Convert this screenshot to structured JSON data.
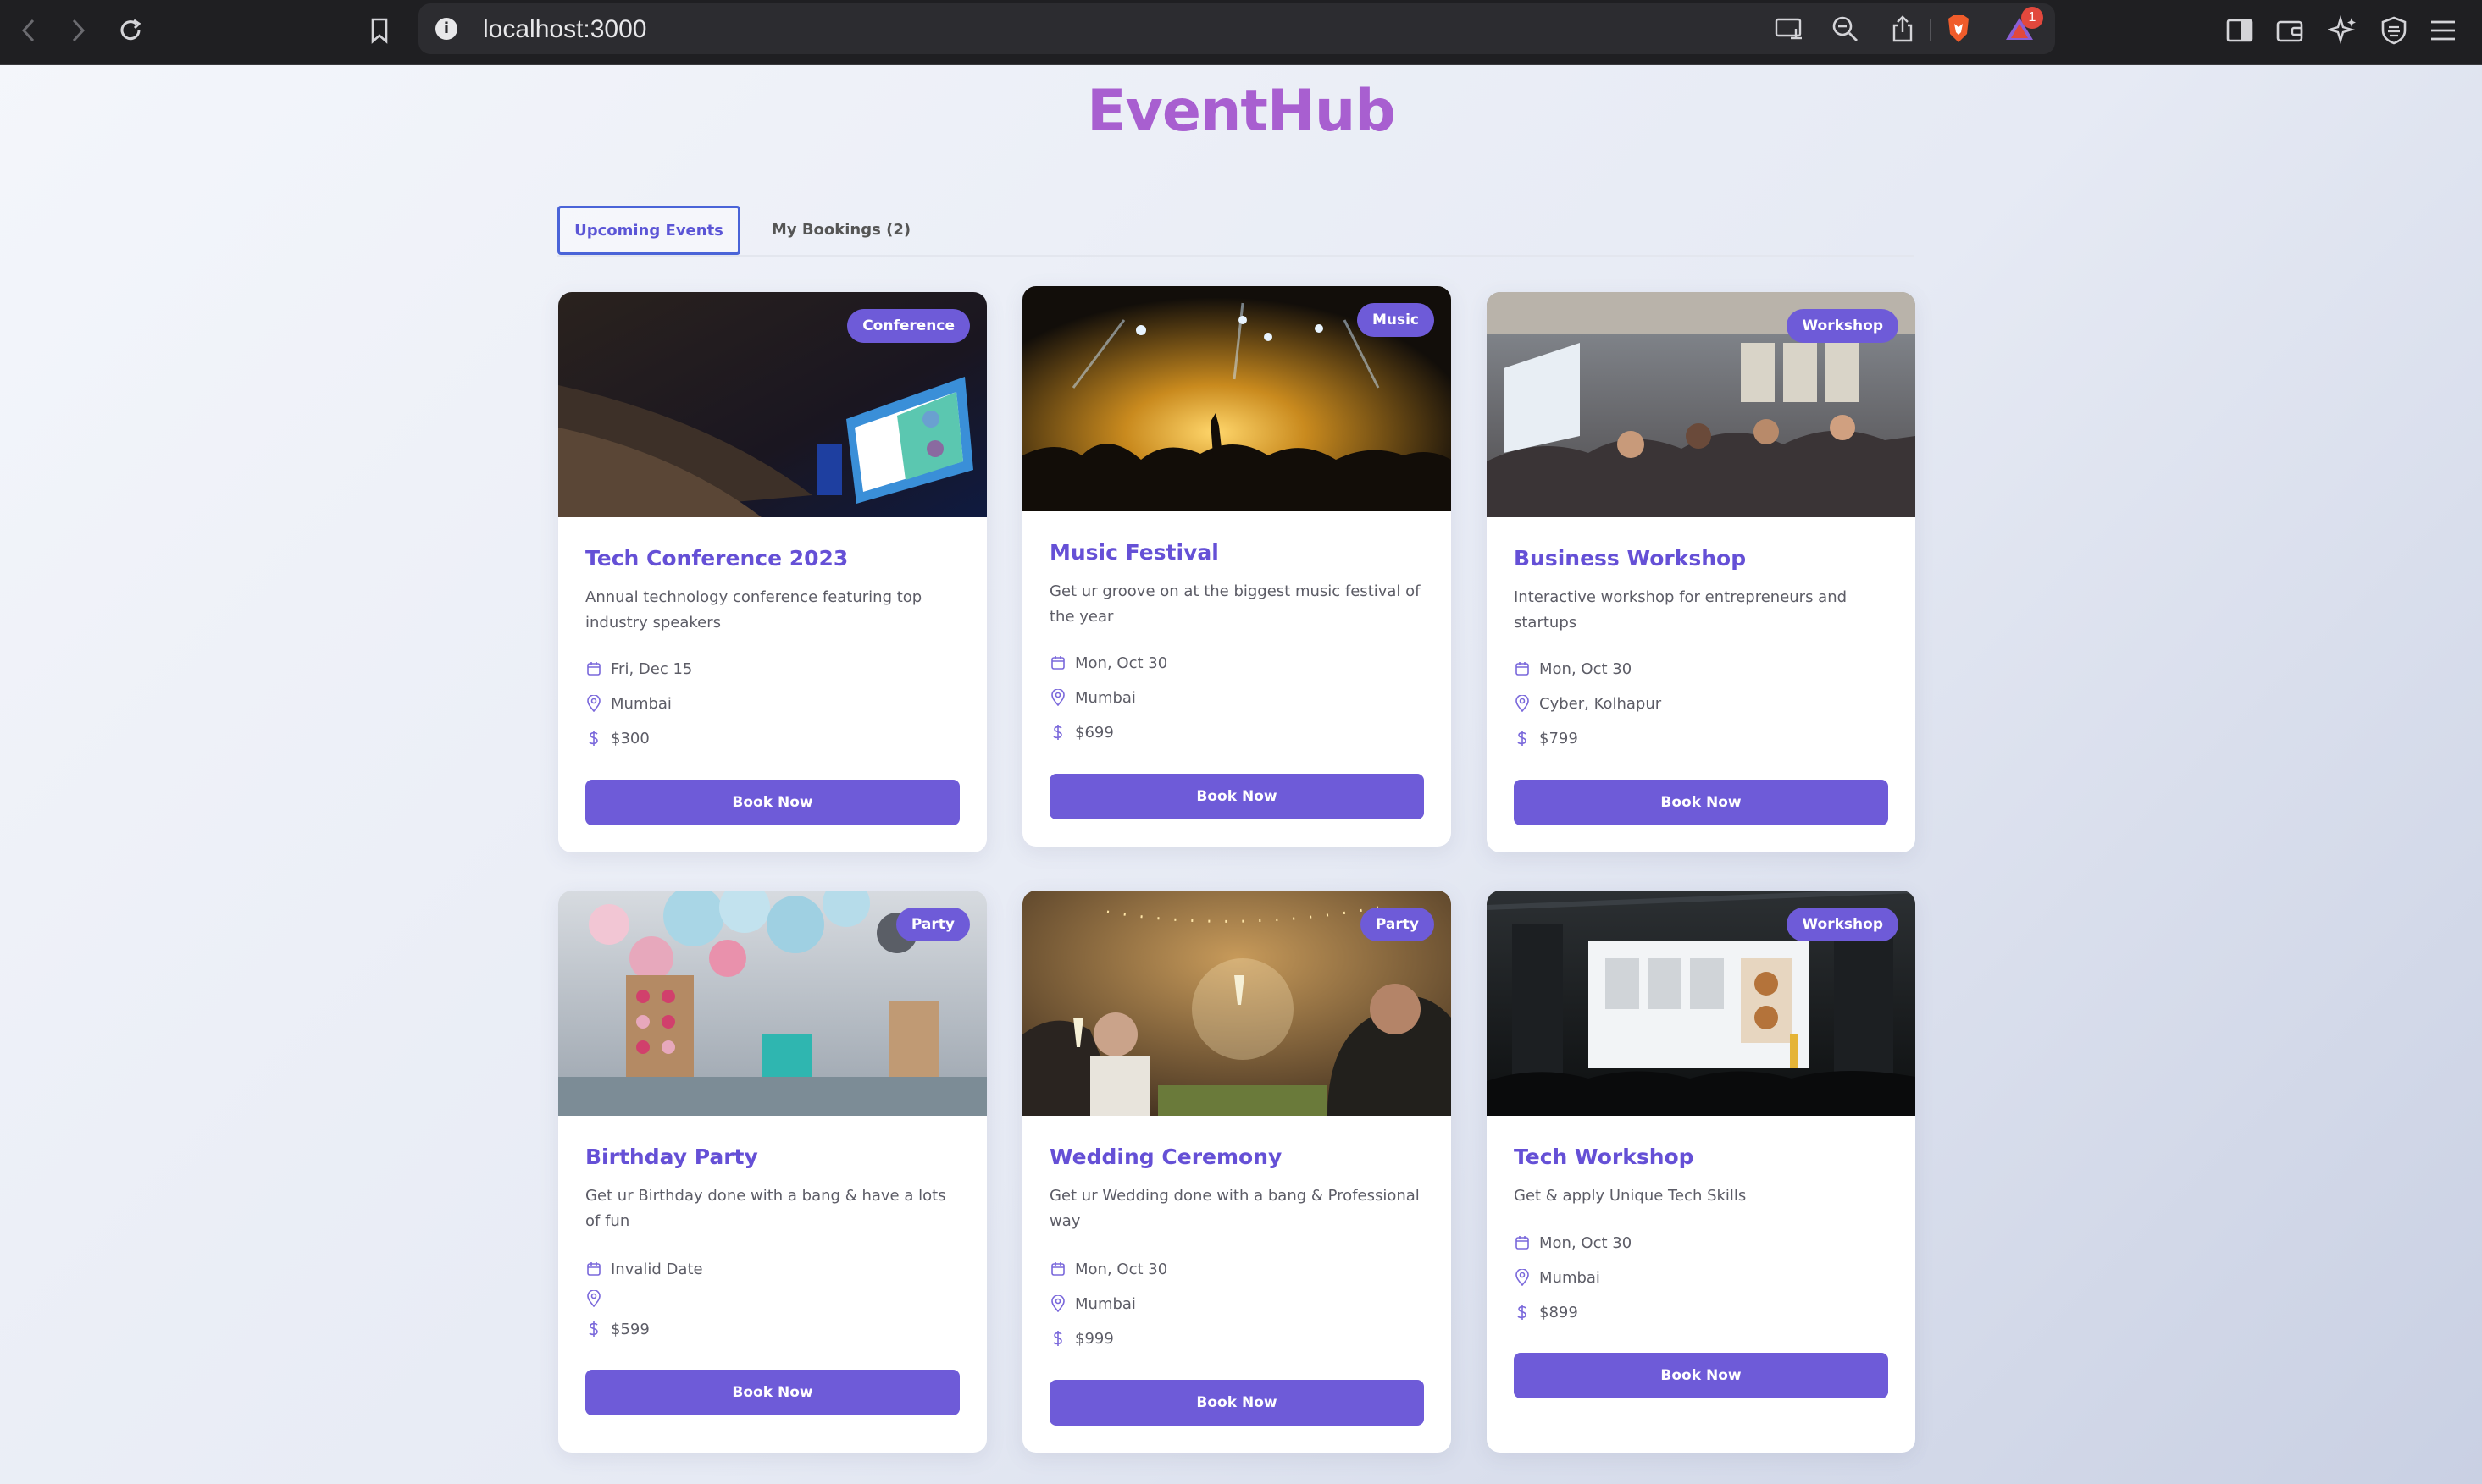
{
  "browser": {
    "url": "localhost:3000",
    "notification_count": "1"
  },
  "app": {
    "title": "EventHub"
  },
  "tabs": [
    {
      "label": "Upcoming Events",
      "active": true
    },
    {
      "label": "My Bookings (2)",
      "active": false
    }
  ],
  "colors": {
    "accent": "#6e5bd8",
    "title": "#a85fd0",
    "tab_border": "#4a64d8"
  },
  "events": [
    {
      "category": "Conference",
      "name": "Tech Conference 2023",
      "description": "Annual technology conference featuring top industry speakers",
      "date": "Fri, Dec 15",
      "location": "Mumbai",
      "price": "$300",
      "button": "Book Now"
    },
    {
      "category": "Music",
      "name": "Music Festival",
      "description": "Get ur groove on at the biggest music festival of the year",
      "date": "Mon, Oct 30",
      "location": "Mumbai",
      "price": "$699",
      "button": "Book Now"
    },
    {
      "category": "Workshop",
      "name": "Business Workshop",
      "description": "Interactive workshop for entrepreneurs and startups",
      "date": "Mon, Oct 30",
      "location": "Cyber, Kolhapur",
      "price": "$799",
      "button": "Book Now"
    },
    {
      "category": "Party",
      "name": "Birthday Party",
      "description": "Get ur Birthday done with a bang & have a lots of fun",
      "date": "Invalid Date",
      "location": "",
      "price": "$599",
      "button": "Book Now"
    },
    {
      "category": "Party",
      "name": "Wedding Ceremony",
      "description": "Get ur Wedding done with a bang & Professional way",
      "date": "Mon, Oct 30",
      "location": "Mumbai",
      "price": "$999",
      "button": "Book Now"
    },
    {
      "category": "Workshop",
      "name": "Tech Workshop",
      "description": "Get & apply Unique Tech Skills",
      "date": "Mon, Oct 30",
      "location": "Mumbai",
      "price": "$899",
      "button": "Book Now"
    }
  ]
}
